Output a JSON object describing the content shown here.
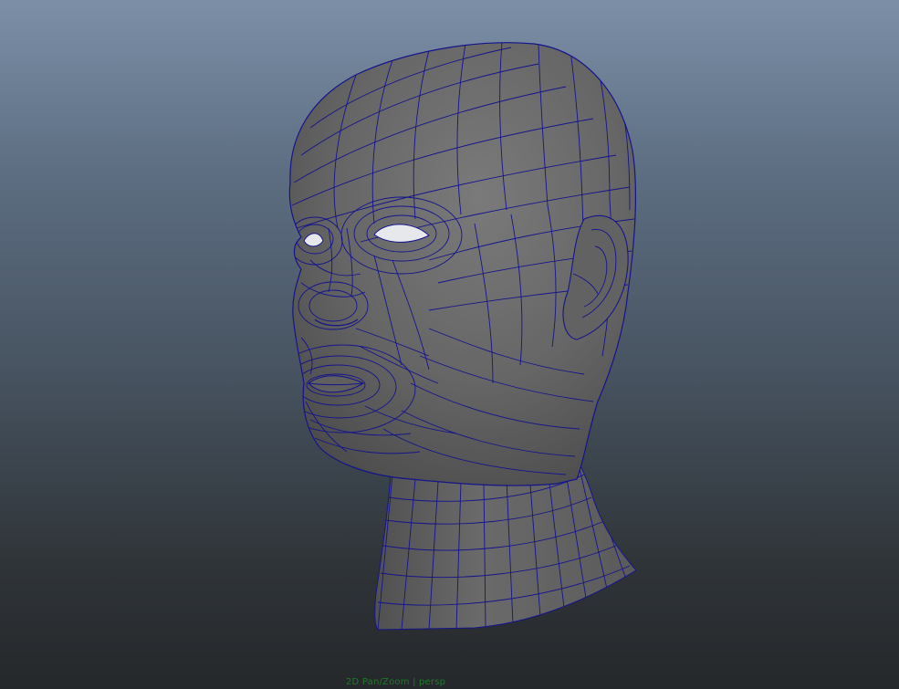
{
  "viewport": {
    "camera": "persp",
    "tool_label": "2D Pan/Zoom | persp",
    "object": "head-mesh",
    "display_mode": "shaded-wireframe",
    "colors": {
      "background_top": "#7c8fa7",
      "background_bottom": "#25282b",
      "mesh_fill": "#6e6e6e",
      "wire_color": "#14148c",
      "hud_text": "#1f7a2a"
    }
  }
}
